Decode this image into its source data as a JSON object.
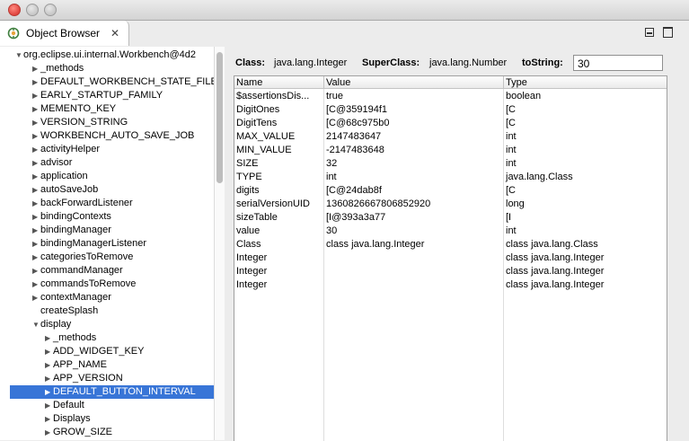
{
  "window": {
    "controls": [
      "close-button",
      "minimize-button",
      "zoom-button"
    ]
  },
  "tab": {
    "title": "Object Browser",
    "close_glyph": "✕",
    "icon": "object-browser-icon"
  },
  "tree": {
    "root": "org.eclipse.ui.internal.Workbench@4d2",
    "items": [
      {
        "label": "_methods",
        "level": 1,
        "state": "collapsed"
      },
      {
        "label": "DEFAULT_WORKBENCH_STATE_FILEN",
        "level": 1,
        "state": "collapsed"
      },
      {
        "label": "EARLY_STARTUP_FAMILY",
        "level": 1,
        "state": "collapsed"
      },
      {
        "label": "MEMENTO_KEY",
        "level": 1,
        "state": "collapsed"
      },
      {
        "label": "VERSION_STRING",
        "level": 1,
        "state": "collapsed"
      },
      {
        "label": "WORKBENCH_AUTO_SAVE_JOB",
        "level": 1,
        "state": "collapsed"
      },
      {
        "label": "activityHelper",
        "level": 1,
        "state": "collapsed"
      },
      {
        "label": "advisor",
        "level": 1,
        "state": "collapsed"
      },
      {
        "label": "application",
        "level": 1,
        "state": "collapsed"
      },
      {
        "label": "autoSaveJob",
        "level": 1,
        "state": "collapsed"
      },
      {
        "label": "backForwardListener",
        "level": 1,
        "state": "collapsed"
      },
      {
        "label": "bindingContexts",
        "level": 1,
        "state": "collapsed"
      },
      {
        "label": "bindingManager",
        "level": 1,
        "state": "collapsed"
      },
      {
        "label": "bindingManagerListener",
        "level": 1,
        "state": "collapsed"
      },
      {
        "label": "categoriesToRemove",
        "level": 1,
        "state": "collapsed"
      },
      {
        "label": "commandManager",
        "level": 1,
        "state": "collapsed"
      },
      {
        "label": "commandsToRemove",
        "level": 1,
        "state": "collapsed"
      },
      {
        "label": "contextManager",
        "level": 1,
        "state": "collapsed"
      },
      {
        "label": "createSplash",
        "level": 1,
        "state": "leaf"
      },
      {
        "label": "display",
        "level": 1,
        "state": "expanded"
      },
      {
        "label": "_methods",
        "level": 2,
        "state": "collapsed"
      },
      {
        "label": "ADD_WIDGET_KEY",
        "level": 2,
        "state": "collapsed"
      },
      {
        "label": "APP_NAME",
        "level": 2,
        "state": "collapsed"
      },
      {
        "label": "APP_VERSION",
        "level": 2,
        "state": "collapsed"
      },
      {
        "label": "DEFAULT_BUTTON_INTERVAL",
        "level": 2,
        "state": "collapsed",
        "selected": true
      },
      {
        "label": "Default",
        "level": 2,
        "state": "collapsed"
      },
      {
        "label": "Displays",
        "level": 2,
        "state": "collapsed"
      },
      {
        "label": "GROW_SIZE",
        "level": 2,
        "state": "collapsed"
      }
    ]
  },
  "header": {
    "class_label": "Class:",
    "class_value": "java.lang.Integer",
    "superclass_label": "SuperClass:",
    "superclass_value": "java.lang.Number",
    "tostring_label": "toString:",
    "tostring_value": "30"
  },
  "table": {
    "columns": [
      "Name",
      "Value",
      "Type"
    ],
    "rows": [
      [
        "$assertionsDis...",
        "true",
        "boolean"
      ],
      [
        "DigitOnes",
        "[C@359194f1",
        "[C"
      ],
      [
        "DigitTens",
        "[C@68c975b0",
        "[C"
      ],
      [
        "MAX_VALUE",
        "2147483647",
        "int"
      ],
      [
        "MIN_VALUE",
        "-2147483648",
        "int"
      ],
      [
        "SIZE",
        "32",
        "int"
      ],
      [
        "TYPE",
        "int",
        "java.lang.Class"
      ],
      [
        "digits",
        "[C@24dab8f",
        "[C"
      ],
      [
        "serialVersionUID",
        "1360826667806852920",
        "long"
      ],
      [
        "sizeTable",
        "[I@393a3a77",
        "[I"
      ],
      [
        "value",
        "30",
        "int"
      ],
      [
        "Class",
        "class java.lang.Integer",
        "class java.lang.Class"
      ],
      [
        "Integer",
        "",
        "class java.lang.Integer"
      ],
      [
        "Integer",
        "",
        "class java.lang.Integer"
      ],
      [
        "Integer",
        "",
        "class java.lang.Integer"
      ]
    ]
  }
}
